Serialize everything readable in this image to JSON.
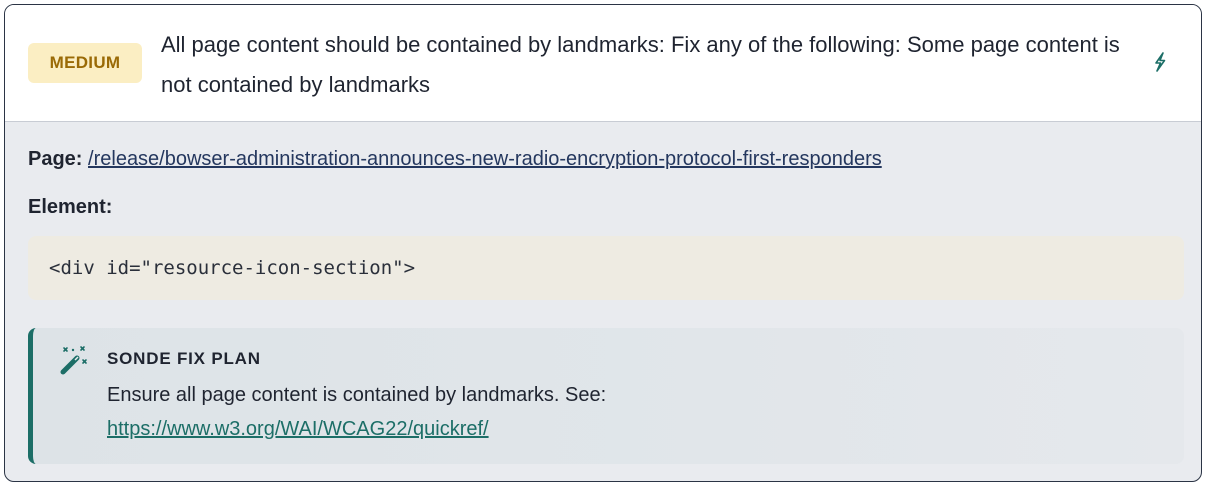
{
  "issue": {
    "severity": "MEDIUM",
    "title": "All page content should be contained by landmarks: Fix any of the following: Some page content is not contained by landmarks",
    "action_icon": "bolt-icon"
  },
  "details": {
    "page_label": "Page:",
    "page_url": "/release/bowser-administration-announces-new-radio-encryption-protocol-first-responders",
    "element_label": "Element:",
    "element_code": "<div id=\"resource-icon-section\">"
  },
  "fix_plan": {
    "icon": "magic-wand-icon",
    "title": "SONDE FIX PLAN",
    "text": "Ensure all page content is contained by landmarks. See:",
    "link": "https://www.w3.org/WAI/WCAG22/quickref/"
  },
  "colors": {
    "badge_bg": "#fbeec3",
    "badge_text": "#9a6a06",
    "accent": "#1c6e67",
    "link": "#24375e"
  }
}
